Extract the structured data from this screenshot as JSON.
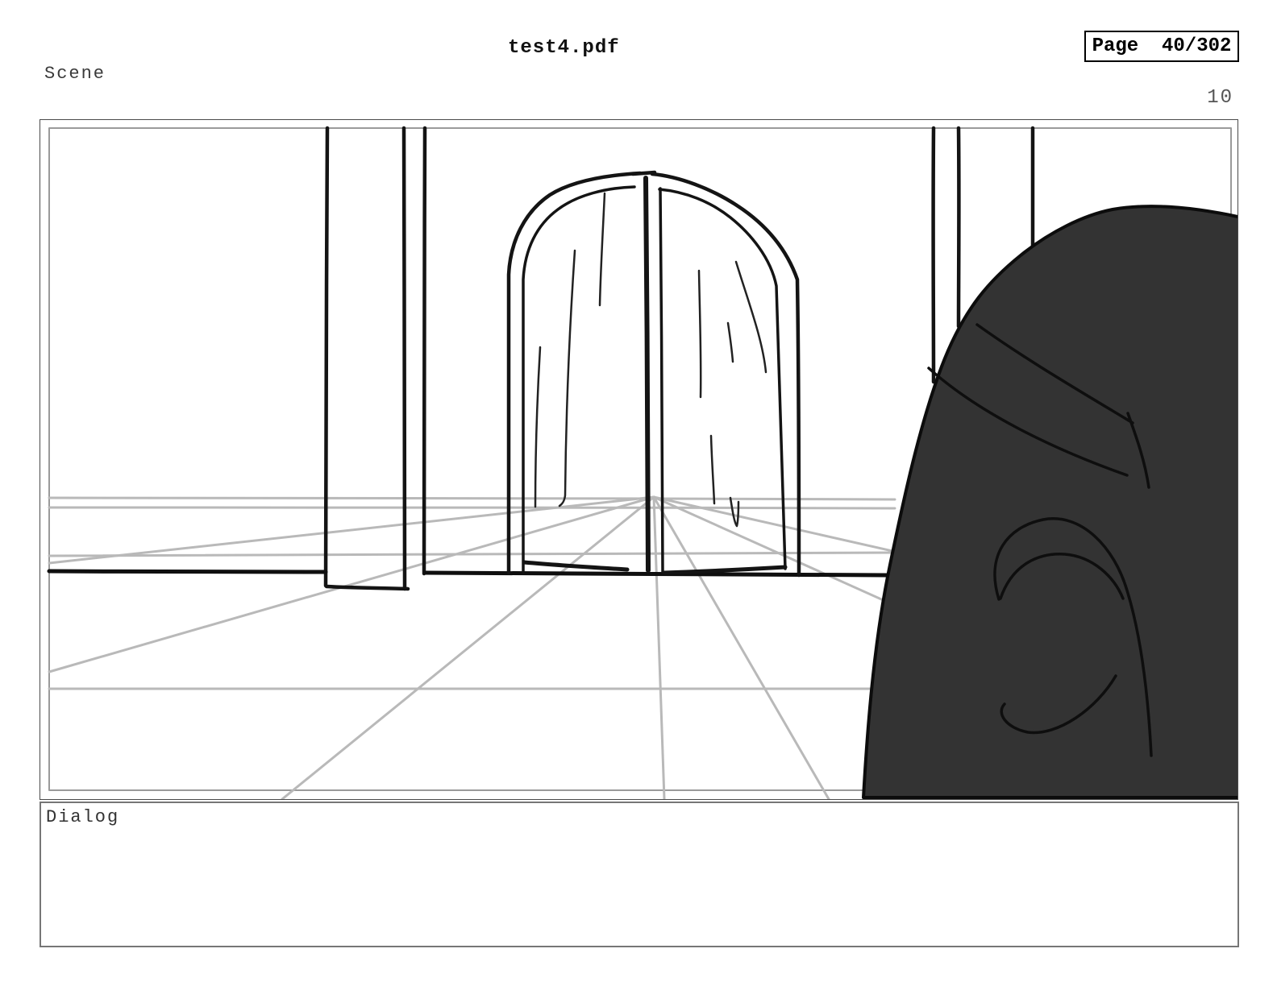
{
  "header": {
    "title": "test4.pdf",
    "page_label": "Page  40/302",
    "scene_label": "Scene",
    "scene_number": "10"
  },
  "dialog": {
    "label": "Dialog"
  },
  "drawing": {
    "description": "one-point perspective hallway sketch with arched double door, wall pillars and dark silhouette of a head in right foreground",
    "colors": {
      "sketch_ink": "#141414",
      "perspective_gray": "#b9b9b9",
      "frame_gray": "#9a9a9a",
      "figure_fill": "#333333",
      "figure_outline": "#0c0c0c"
    }
  }
}
